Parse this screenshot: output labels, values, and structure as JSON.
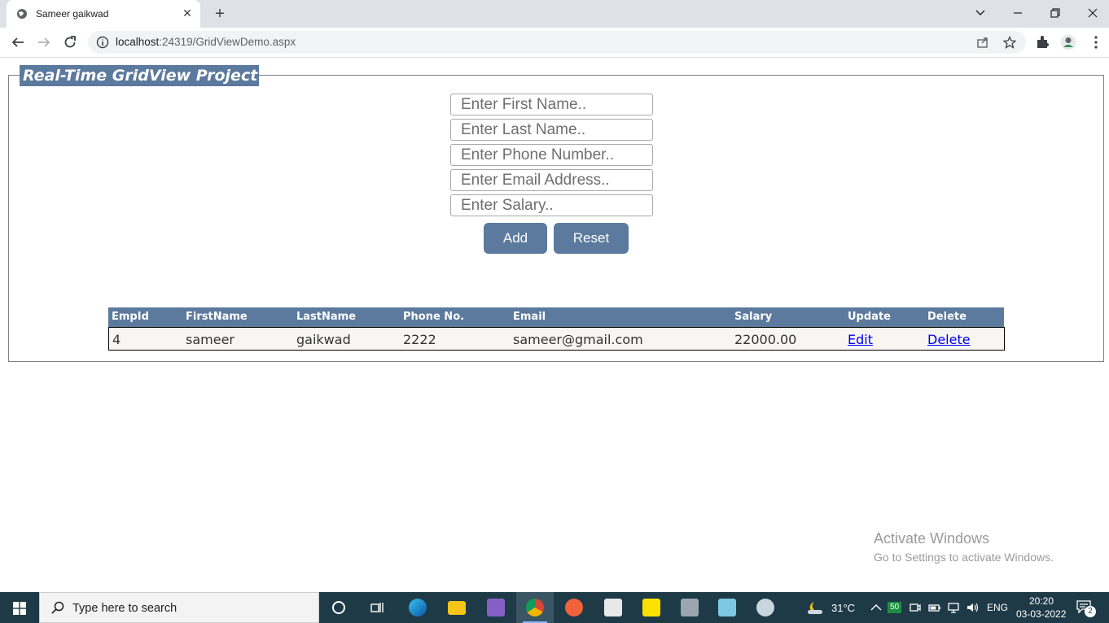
{
  "browser": {
    "tab_title": "Sameer gaikwad",
    "url_host": "localhost",
    "url_path": ":24319/GridViewDemo.aspx"
  },
  "page": {
    "legend": "Real-Time GridView Project",
    "form": {
      "first_name_placeholder": "Enter First Name..",
      "last_name_placeholder": "Enter Last Name..",
      "phone_placeholder": "Enter Phone Number..",
      "email_placeholder": "Enter Email Address..",
      "salary_placeholder": "Enter Salary..",
      "add_label": "Add",
      "reset_label": "Reset"
    },
    "grid": {
      "headers": [
        "EmpId",
        "FirstName",
        "LastName",
        "Phone No.",
        "Email",
        "Salary",
        "Update",
        "Delete"
      ],
      "rows": [
        {
          "empid": "4",
          "firstname": "sameer",
          "lastname": "gaikwad",
          "phone": "2222",
          "email": "sameer@gmail.com",
          "salary": "22000.00",
          "update": "Edit",
          "delete": "Delete"
        }
      ]
    }
  },
  "watermark": {
    "title": "Activate Windows",
    "subtitle": "Go to Settings to activate Windows."
  },
  "taskbar": {
    "search_placeholder": "Type here to search",
    "weather": "31°C",
    "badge": "50",
    "language": "ENG",
    "time": "20:20",
    "date": "03-03-2022",
    "notification_count": "2"
  },
  "colors": {
    "accent": "#5b7a9d",
    "row_background": "#f7f6f3",
    "link": "#0000ee",
    "taskbar": "#1f3a47"
  }
}
